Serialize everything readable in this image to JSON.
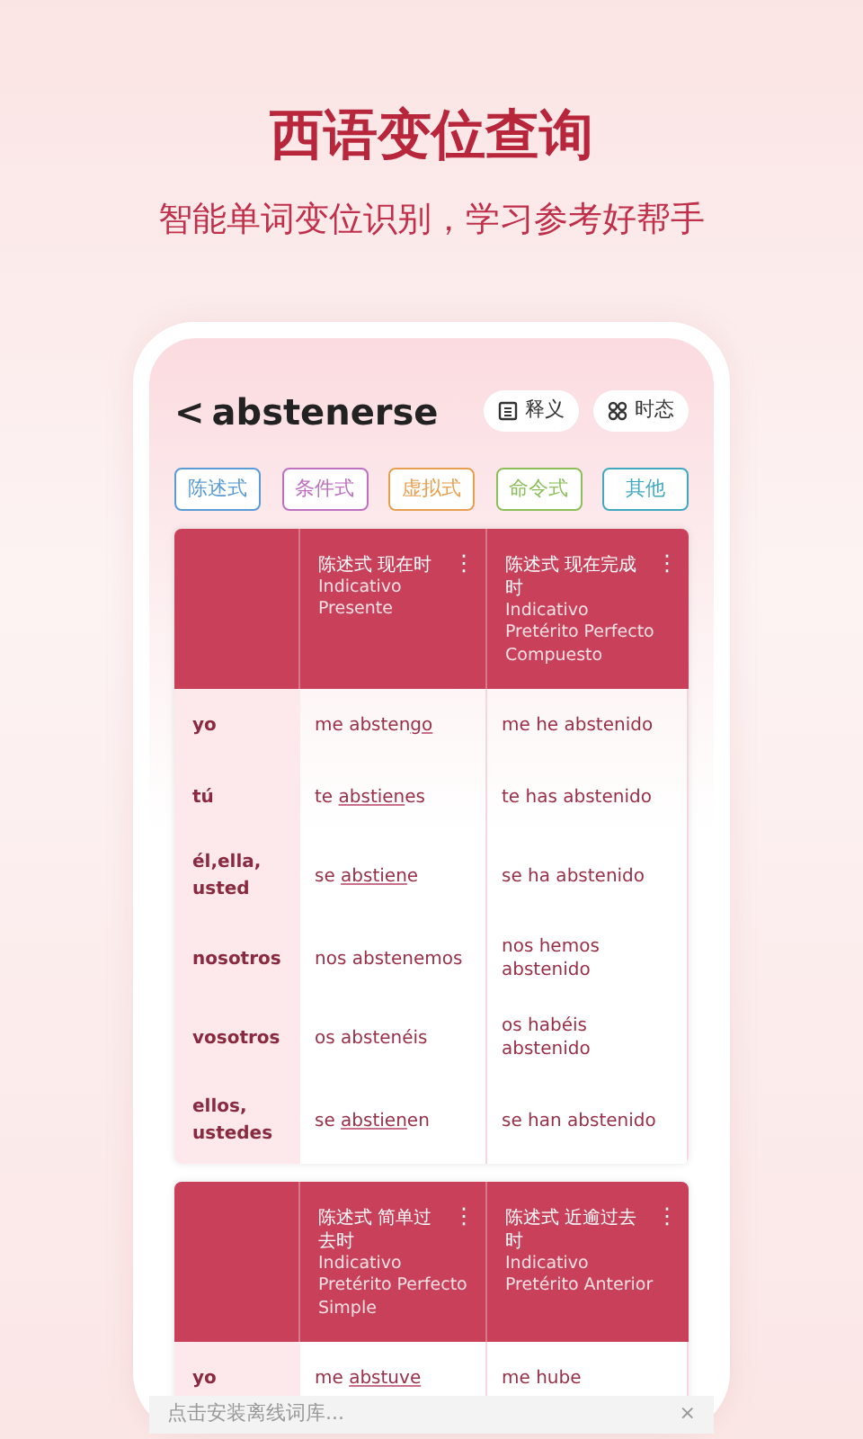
{
  "headline": "西语变位查询",
  "subtitle": "智能单词变位识别，学习参考好帮手",
  "app": {
    "back": "<",
    "word": "abstenerse",
    "actions": [
      {
        "kind": "definition",
        "label": "释义"
      },
      {
        "kind": "tenses",
        "label": "时态"
      }
    ]
  },
  "moods": [
    {
      "label": "陈述式",
      "color": "#5b9bd5"
    },
    {
      "label": "条件式",
      "color": "#c070c0"
    },
    {
      "label": "虚拟式",
      "color": "#e8a050"
    },
    {
      "label": "命令式",
      "color": "#8cbf5a"
    },
    {
      "label": "其他",
      "color": "#40a8c0"
    }
  ],
  "tables": [
    {
      "columns": [
        {
          "zh": "陈述式 现在时",
          "es": "Indicativo\nPresente",
          "menu": "⋮"
        },
        {
          "zh": "陈述式 现在完成时",
          "es": "Indicativo\nPretérito Perfecto\nCompuesto",
          "menu": "⋮"
        }
      ],
      "rows": [
        {
          "person": "yo",
          "cells": [
            [
              {
                "t": "me absten",
                "irregular": false
              },
              {
                "t": "go",
                "irregular": true
              }
            ],
            [
              {
                "t": "me he abstenido",
                "irregular": false
              }
            ]
          ]
        },
        {
          "person": "tú",
          "cells": [
            [
              {
                "t": "te ",
                "irregular": false
              },
              {
                "t": "abstien",
                "irregular": true
              },
              {
                "t": "es",
                "irregular": false
              }
            ],
            [
              {
                "t": "te has abstenido",
                "irregular": false
              }
            ]
          ]
        },
        {
          "person": "él,ella, usted",
          "cells": [
            [
              {
                "t": "se ",
                "irregular": false
              },
              {
                "t": "abstien",
                "irregular": true
              },
              {
                "t": "e",
                "irregular": false
              }
            ],
            [
              {
                "t": "se ha abstenido",
                "irregular": false
              }
            ]
          ]
        },
        {
          "person": "nosotros",
          "cells": [
            [
              {
                "t": "nos abstenemos",
                "irregular": false
              }
            ],
            [
              {
                "t": "nos hemos abstenido",
                "irregular": false
              }
            ]
          ]
        },
        {
          "person": "vosotros",
          "cells": [
            [
              {
                "t": "os abstenéis",
                "irregular": false
              }
            ],
            [
              {
                "t": "os habéis abstenido",
                "irregular": false
              }
            ]
          ]
        },
        {
          "person": "ellos, ustedes",
          "cells": [
            [
              {
                "t": "se ",
                "irregular": false
              },
              {
                "t": "abstien",
                "irregular": true
              },
              {
                "t": "en",
                "irregular": false
              }
            ],
            [
              {
                "t": "se han abstenido",
                "irregular": false
              }
            ]
          ]
        }
      ]
    },
    {
      "columns": [
        {
          "zh": "陈述式 简单过去时",
          "es": "Indicativo\nPretérito Perfecto\nSimple",
          "menu": "⋮"
        },
        {
          "zh": "陈述式 近逾过去时",
          "es": "Indicativo\nPretérito Anterior",
          "menu": "⋮"
        }
      ],
      "rows": [
        {
          "person": "yo",
          "cells": [
            [
              {
                "t": "me ",
                "irregular": false
              },
              {
                "t": "abstuve",
                "irregular": true
              }
            ],
            [
              {
                "t": "me hube",
                "irregular": false
              }
            ]
          ]
        }
      ]
    }
  ],
  "banner": {
    "text": "点击安装离线词库...",
    "close": "×"
  }
}
